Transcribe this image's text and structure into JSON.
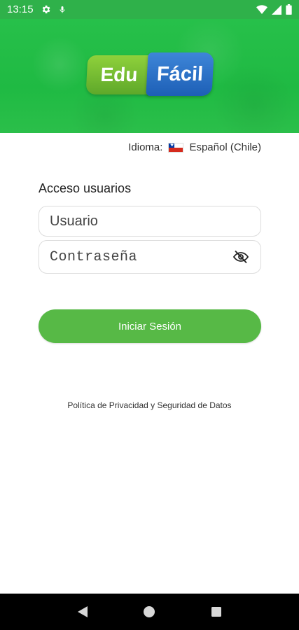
{
  "status_bar": {
    "time": "13:15",
    "left_icons": [
      "settings-icon",
      "microphone-icon"
    ],
    "right_icons": [
      "wifi-icon",
      "signal-icon",
      "battery-icon"
    ],
    "background_color": "#2fb14a"
  },
  "header": {
    "logo_left": "Edu",
    "logo_right": "Fácil",
    "logo_left_color": "#6cb72f",
    "logo_right_color": "#2a6cc4"
  },
  "language": {
    "label": "Idioma:",
    "flag_icon": "chile-flag-icon",
    "value": "Español (Chile)"
  },
  "login": {
    "title": "Acceso usuarios",
    "username_placeholder": "Usuario",
    "username_value": "",
    "password_placeholder": "Contraseña",
    "password_value": "",
    "toggle_visibility_icon": "eye-off-icon",
    "submit_label": "Iniciar Sesión",
    "accent_color": "#57b946"
  },
  "footer": {
    "privacy_link": "Política de Privacidad y Seguridad de Datos"
  },
  "nav_bar": {
    "buttons": [
      "back-icon",
      "home-icon",
      "recents-icon"
    ]
  }
}
